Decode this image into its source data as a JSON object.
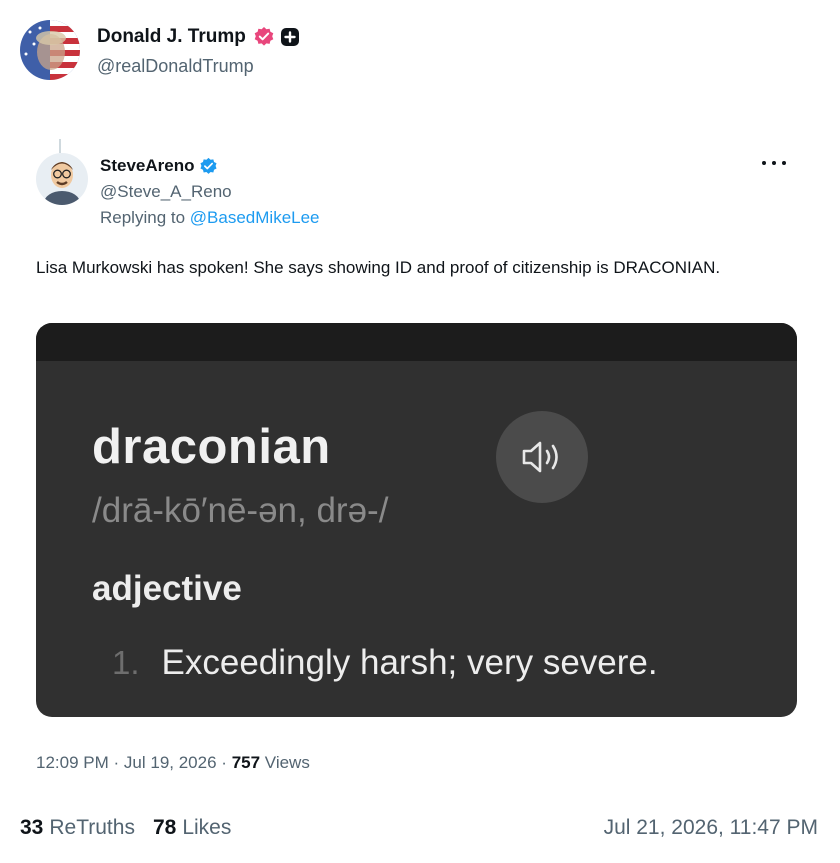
{
  "post": {
    "author": {
      "display_name": "Donald J. Trump",
      "handle": "@realDonaldTrump",
      "verified_badge_color": "#e8467c",
      "avatar_icon": "flag-portrait-avatar"
    },
    "quoted": {
      "author": {
        "display_name": "SteveAreno",
        "handle": "@Steve_A_Reno",
        "verified_badge_color": "#1d9bf0",
        "avatar_icon": "cartoon-avatar"
      },
      "reply_prefix": "Replying to",
      "reply_mention": "@BasedMikeLee",
      "body": "Lisa Murkowski has spoken! She says showing ID and proof of citizenship is DRACONIAN.",
      "image": {
        "word": "draconian",
        "pronunciation": "/drā-kō′nē-ən, drə-/",
        "part_of_speech": "adjective",
        "definition_number": "1.",
        "definition": "Exceedingly harsh; very severe.",
        "speaker_icon": "speaker-icon"
      },
      "footer": {
        "time": "12:09 PM",
        "separator": "·",
        "date": "Jul 19, 2026",
        "views_count": "757",
        "views_label": "Views"
      }
    },
    "stats": {
      "retruths_count": "33",
      "retruths_label": "ReTruths",
      "likes_count": "78",
      "likes_label": "Likes",
      "timestamp": "Jul 21, 2026, 11:47 PM"
    }
  }
}
